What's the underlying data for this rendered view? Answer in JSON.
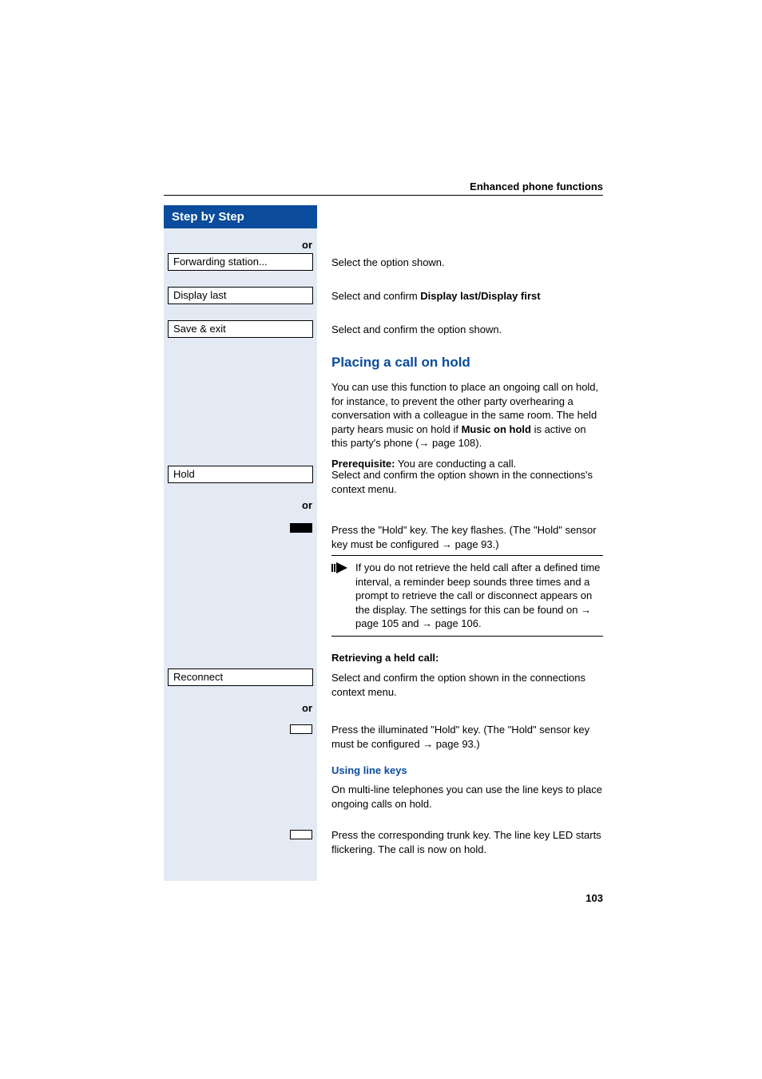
{
  "header": {
    "section": "Enhanced phone functions"
  },
  "sidebar": {
    "title": "Step by Step",
    "or1": "or",
    "box1": "Forwarding station...",
    "box2": "Display last",
    "box3": "Save & exit",
    "box4": "Hold",
    "or2": "or",
    "box5": "Reconnect",
    "or3": "or"
  },
  "content": {
    "line1": "Select the option shown.",
    "line2_pre": "Select and confirm ",
    "line2_bold": "Display last/Display first",
    "line3": "Select and confirm the option shown.",
    "h2": "Placing a call on hold",
    "para1_a": "You can use this function to place an ongoing call on hold, for instance, to prevent the other party overhearing a conversation with a colleague in the same room. The held party hears music on hold if ",
    "para1_b": "Music on hold",
    "para1_c": " is active on this party's phone (",
    "para1_d": " page 108).",
    "prereq_label": "Prerequisite:",
    "prereq_text": " You are conducting a call.",
    "line4": "Select and confirm the option shown in the connections's context menu.",
    "line5_a": "Press the \"Hold\" key. The key flashes. (The \"Hold\" sensor key must be configured ",
    "line5_b": " page 93.)",
    "note_a": "If you do not retrieve the held call after a defined time interval, a reminder beep sounds three times and a prompt to retrieve the call or disconnect appears on the display. The settings for this can be found on ",
    "note_b": " page 105 and ",
    "note_c": " page 106.",
    "retrieve_header": "Retrieving a held call:",
    "line6": "Select and confirm the option shown in the connections context menu.",
    "line7_a": "Press the illuminated \"Hold\" key. (The \"Hold\" sensor key must be configured ",
    "line7_b": " page 93.)",
    "h3": "Using line keys",
    "para2": "On multi-line telephones you can use the line keys to place ongoing calls on hold.",
    "line8": "Press the corresponding trunk key. The line key LED starts flickering. The call is now on hold."
  },
  "page_number": "103"
}
